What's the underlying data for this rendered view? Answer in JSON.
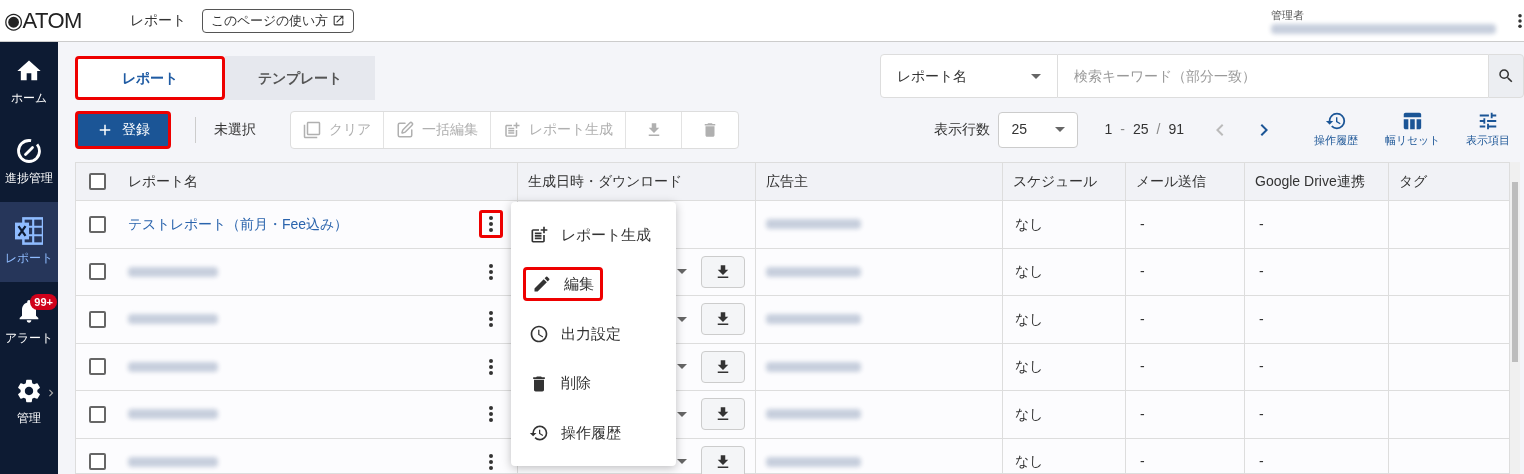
{
  "header": {
    "logo": "◉ATOM",
    "page_title": "レポート",
    "help_link": "このページの使い方",
    "role": "管理者"
  },
  "sidebar": {
    "items": [
      {
        "label": "ホーム",
        "selected": false
      },
      {
        "label": "進捗管理",
        "selected": false
      },
      {
        "label": "レポート",
        "selected": true
      },
      {
        "label": "アラート",
        "selected": false,
        "badge": "99+"
      },
      {
        "label": "管理",
        "selected": false
      }
    ]
  },
  "tabs": [
    {
      "label": "レポート",
      "selected": true,
      "highlighted": true
    },
    {
      "label": "テンプレート",
      "selected": false,
      "highlighted": false
    }
  ],
  "search": {
    "field": "レポート名",
    "placeholder": "検索キーワード（部分一致）"
  },
  "toolbar": {
    "register": {
      "label": "登録",
      "highlighted": true
    },
    "selection": "未選択",
    "actions": [
      {
        "label": "クリア",
        "disabled": true
      },
      {
        "label": "一括編集",
        "disabled": true
      },
      {
        "label": "レポート生成",
        "disabled": true
      },
      {
        "disabled": true
      },
      {
        "disabled": true
      }
    ],
    "rows_label": "表示行数",
    "rows_value": "25",
    "range_start": "1",
    "range_dash": "-",
    "range_end": "25",
    "range_slash": "/",
    "total": "91",
    "prev_disabled": true,
    "next_disabled": false,
    "tools": [
      {
        "label": "操作履歴"
      },
      {
        "label": "幅リセット"
      },
      {
        "label": "表示項目"
      }
    ]
  },
  "table": {
    "select_all_checked": false,
    "columns": [
      "レポート名",
      "生成日時・ダウンロード",
      "広告主",
      "スケジュール",
      "メール送信",
      "Google Drive連携",
      "タグ"
    ],
    "rows": [
      {
        "checked": false,
        "name": "テストレポート（前月・Fee込み）",
        "menu_highlighted": true,
        "has_download": false,
        "schedule": "なし",
        "mail": "-",
        "drive": "-"
      },
      {
        "checked": false,
        "menu_highlighted": false,
        "has_download": true,
        "schedule": "なし",
        "mail": "-",
        "drive": "-"
      },
      {
        "checked": false,
        "menu_highlighted": false,
        "has_download": true,
        "schedule": "なし",
        "mail": "-",
        "drive": "-"
      },
      {
        "checked": false,
        "menu_highlighted": false,
        "has_download": true,
        "schedule": "なし",
        "mail": "-",
        "drive": "-"
      },
      {
        "checked": false,
        "menu_highlighted": false,
        "has_download": true,
        "schedule": "なし",
        "mail": "-",
        "drive": "-"
      },
      {
        "checked": false,
        "menu_highlighted": false,
        "has_download": true,
        "schedule": "なし",
        "mail": "-",
        "drive": "-"
      }
    ]
  },
  "context_menu": {
    "items": [
      {
        "label": "レポート生成",
        "highlighted": false
      },
      {
        "label": "編集",
        "highlighted": true
      },
      {
        "label": "出力設定",
        "highlighted": false
      },
      {
        "label": "削除",
        "highlighted": false
      },
      {
        "label": "操作履歴",
        "highlighted": false
      }
    ]
  }
}
